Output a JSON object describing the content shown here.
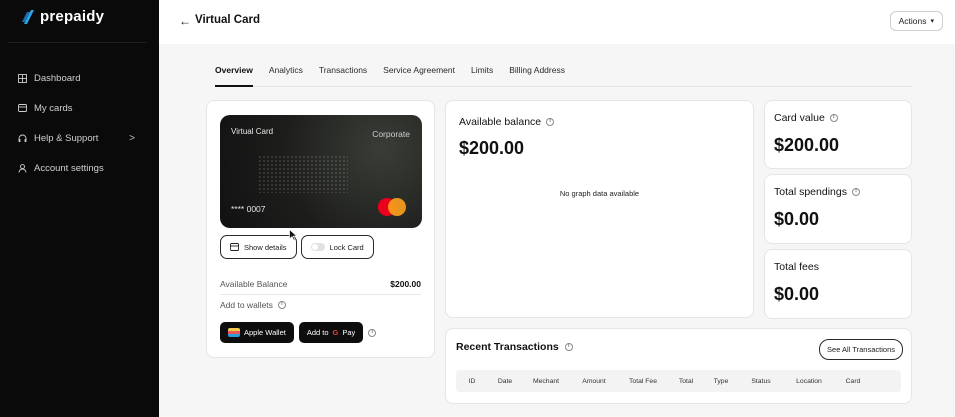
{
  "brand": {
    "name": "prepaidy"
  },
  "sidebar": {
    "items": [
      {
        "label": "Dashboard",
        "icon": "grid-icon"
      },
      {
        "label": "My cards",
        "icon": "card-icon"
      },
      {
        "label": "Help & Support",
        "icon": "headset-icon",
        "chevron": ">"
      },
      {
        "label": "Account settings",
        "icon": "user-icon"
      }
    ]
  },
  "header": {
    "back": "←",
    "title": "Virtual Card",
    "actions_label": "Actions",
    "actions_caret": "▾"
  },
  "tabs": [
    {
      "label": "Overview",
      "active": true
    },
    {
      "label": "Analytics"
    },
    {
      "label": "Transactions"
    },
    {
      "label": "Service Agreement"
    },
    {
      "label": "Limits"
    },
    {
      "label": "Billing Address"
    }
  ],
  "card": {
    "name": "Virtual Card",
    "type": "Corporate",
    "number": "**** 0007",
    "show_details": "Show details",
    "lock_card": "Lock Card",
    "available_balance_label": "Available Balance",
    "available_balance_value": "$200.00",
    "add_to_wallets": "Add to wallets",
    "apple_wallet": "Apple Wallet",
    "gpay_prefix": "Add to",
    "gpay_g": "G",
    "gpay_suffix": "Pay",
    "info_symbol": "i"
  },
  "balance": {
    "title": "Available balance",
    "amount": "$200.00",
    "no_data": "No graph data available"
  },
  "stats": [
    {
      "title": "Card value",
      "amount": "$200.00",
      "info": true
    },
    {
      "title": "Total spendings",
      "amount": "$0.00",
      "info": true
    },
    {
      "title": "Total fees",
      "amount": "$0.00",
      "info": false
    }
  ],
  "transactions": {
    "title": "Recent Transactions",
    "see_all": "See All Transactions",
    "columns": [
      "ID",
      "Date",
      "Mechant",
      "Amount",
      "Total Fee",
      "Total",
      "Type",
      "Status",
      "Location",
      "Card"
    ]
  },
  "colors": {
    "sidebar_bg": "#0a0a0a",
    "accent_blue": "#2aa7e8",
    "mastercard_red": "#eb001b",
    "mastercard_orange": "#f79e1b"
  }
}
